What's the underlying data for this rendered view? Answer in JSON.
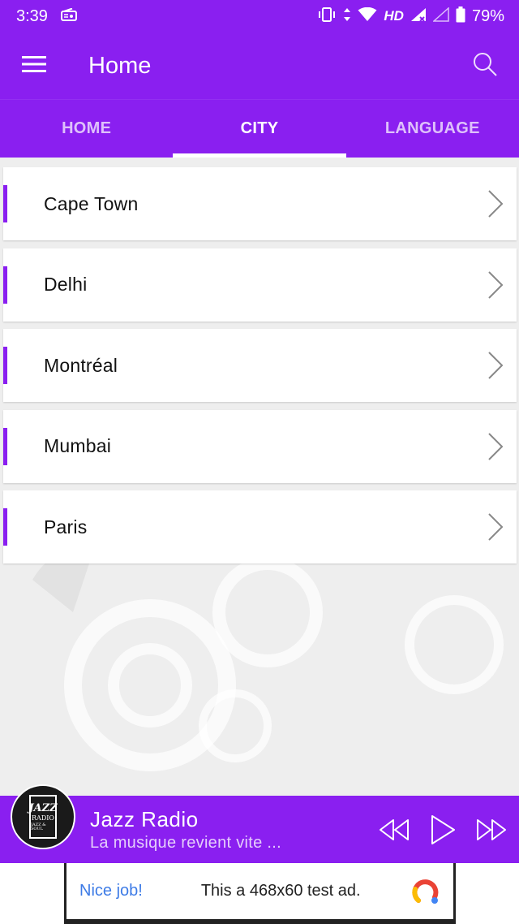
{
  "status_bar": {
    "time": "3:39",
    "network_label": "HD",
    "battery_text": "79%",
    "icons": [
      "radio-icon",
      "vibrate-icon",
      "data-arrows-icon",
      "wifi-icon",
      "signal-icon",
      "signal-empty-icon",
      "battery-icon"
    ]
  },
  "app_bar": {
    "title": "Home",
    "menu_icon": "menu-icon",
    "search_icon": "search-icon"
  },
  "tabs": [
    {
      "label": "HOME",
      "active": false
    },
    {
      "label": "CITY",
      "active": true
    },
    {
      "label": "LANGUAGE",
      "active": false
    }
  ],
  "cities": [
    {
      "label": "Cape Town"
    },
    {
      "label": "Delhi"
    },
    {
      "label": "Montréal"
    },
    {
      "label": "Mumbai"
    },
    {
      "label": "Paris"
    }
  ],
  "player": {
    "title": "Jazz Radio",
    "subtitle": "La musique revient vite ...",
    "logo_text": [
      "JAZZ",
      "RADIO",
      "JAZZ & SOUL"
    ],
    "controls": [
      "rewind-icon",
      "play-icon",
      "fast-forward-icon"
    ]
  },
  "ad": {
    "nice_text": "Nice job!",
    "text": "This a 468x60 test ad."
  },
  "colors": {
    "primary": "#8a1ff0",
    "ad_link": "#3d7be6"
  }
}
